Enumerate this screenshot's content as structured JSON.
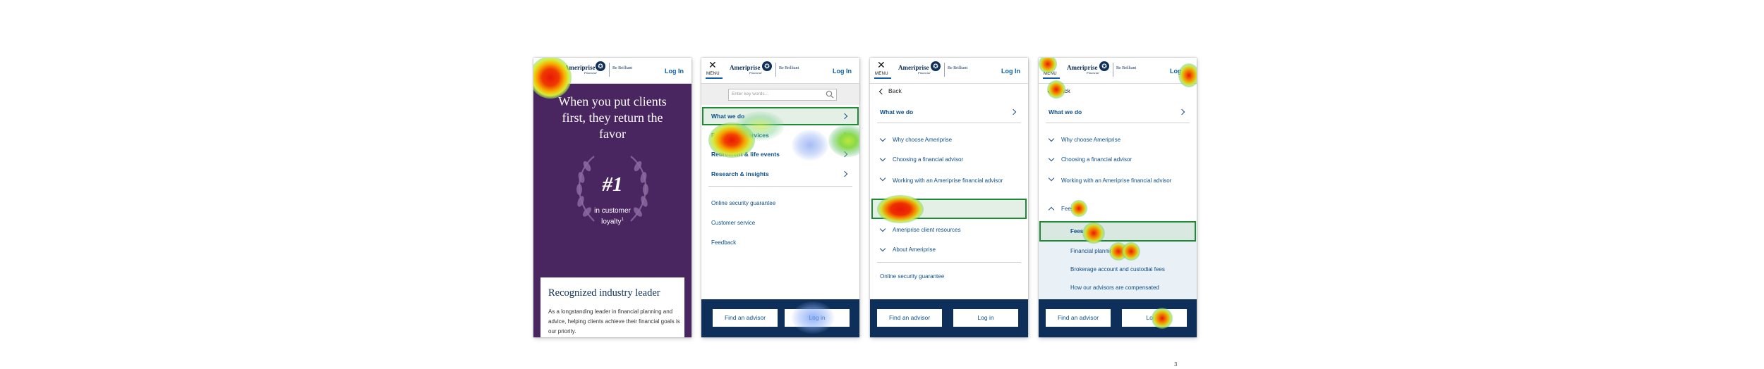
{
  "brand": {
    "name": "Ameriprise",
    "sub": "Financial",
    "tagline": "Be Brilliant"
  },
  "header": {
    "login": "Log In",
    "menu_label": "MENU"
  },
  "screen1": {
    "hero_title": "When you put clients first, they return the favor",
    "rank": "#1",
    "rank_sub": "in customer loyalty",
    "rank_sup": "1",
    "card_title": "Recognized industry leader",
    "card_text": "As a longstanding leader in financial planning and advice, helping clients achieve their financial goals is our priority."
  },
  "screen2": {
    "search_placeholder": "Enter key words...",
    "menu_items": [
      "What we do",
      "Products & services",
      "Retirement & life events",
      "Research & insights"
    ],
    "links": [
      "Online security guarantee",
      "Customer service",
      "Feedback"
    ],
    "buttons": [
      "Find an advisor",
      "Log in"
    ]
  },
  "screen3": {
    "back": "Back",
    "section": "What we do",
    "items": [
      "Why choose Ameriprise",
      "Choosing a financial advisor",
      "Working with an Ameriprise financial advisor",
      "Fees",
      "Ameriprise client resources",
      "About Ameriprise"
    ],
    "link": "Online security guarantee",
    "buttons": [
      "Find an advisor",
      "Log in"
    ]
  },
  "screen4": {
    "back": "Back",
    "section": "What we do",
    "items": [
      "Why choose Ameriprise",
      "Choosing a financial advisor",
      "Working with an Ameriprise financial advisor",
      "Fees"
    ],
    "sub_items": [
      "Fees",
      "Financial planning",
      "Brokerage account and custodial fees",
      "How our advisors are compensated"
    ],
    "buttons": [
      "Find an advisor",
      "Log in"
    ]
  },
  "page_number": "3",
  "colors": {
    "navy": "#0d2f5a",
    "purple": "#4a2660",
    "link": "#0d4f8a",
    "highlight": "#1c8b34"
  }
}
